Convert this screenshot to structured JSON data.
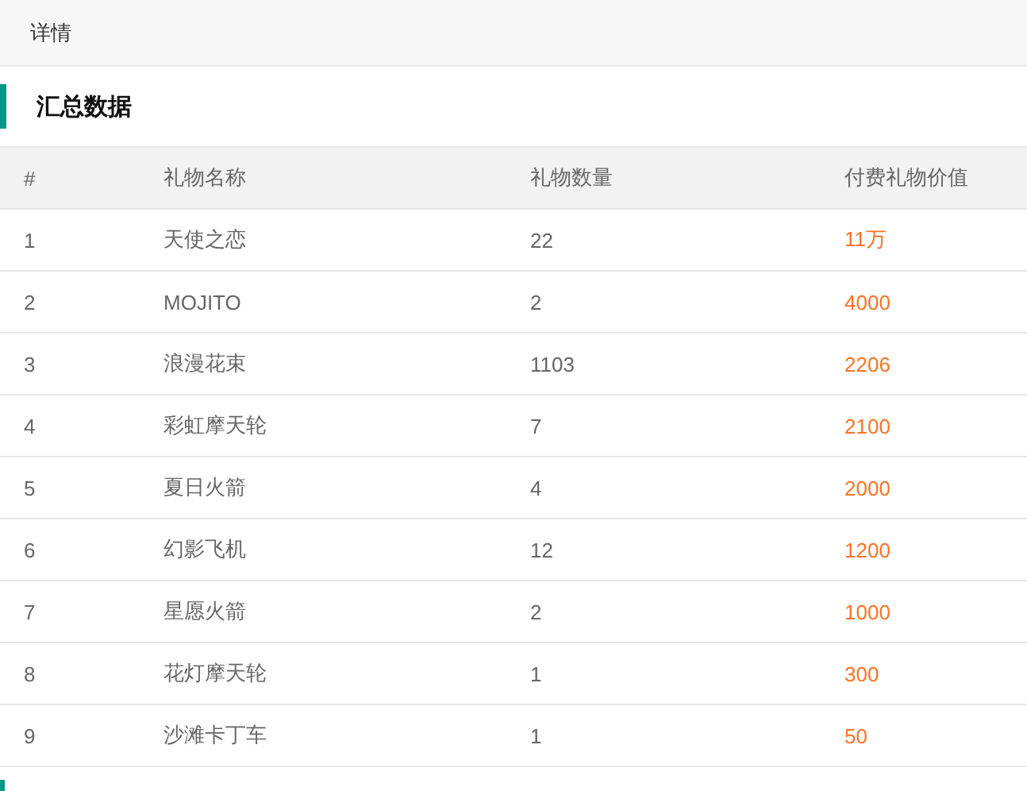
{
  "header": {
    "title": "详情"
  },
  "section": {
    "title": "汇总数据"
  },
  "table": {
    "columns": [
      "#",
      "礼物名称",
      "礼物数量",
      "付费礼物价值"
    ],
    "rows": [
      {
        "cells": [
          "1",
          "天使之恋",
          "22",
          "11万"
        ]
      },
      {
        "cells": [
          "2",
          "MOJITO",
          "2",
          "4000"
        ]
      },
      {
        "cells": [
          "3",
          "浪漫花束",
          "1103",
          "2206"
        ]
      },
      {
        "cells": [
          "4",
          "彩虹摩天轮",
          "7",
          "2100"
        ]
      },
      {
        "cells": [
          "5",
          "夏日火箭",
          "4",
          "2000"
        ]
      },
      {
        "cells": [
          "6",
          "幻影飞机",
          "12",
          "1200"
        ]
      },
      {
        "cells": [
          "7",
          "星愿火箭",
          "2",
          "1000"
        ]
      },
      {
        "cells": [
          "8",
          "花灯摩天轮",
          "1",
          "300"
        ]
      },
      {
        "cells": [
          "9",
          "沙滩卡丁车",
          "1",
          "50"
        ]
      }
    ]
  }
}
